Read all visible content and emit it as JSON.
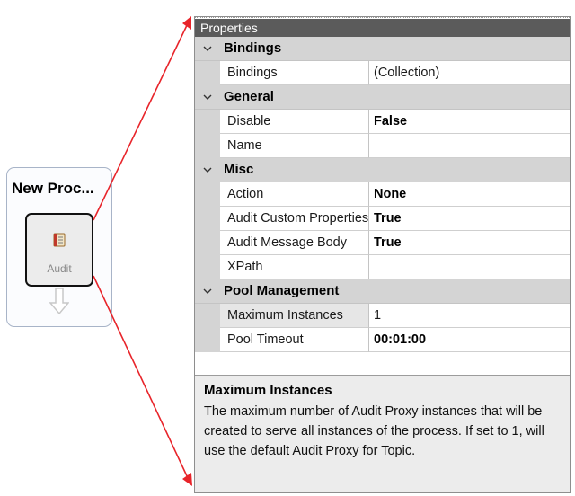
{
  "node": {
    "title": "New Proc...",
    "shape_label": "Audit",
    "shape_icon": "audit-book-icon"
  },
  "panel": {
    "title": "Properties",
    "categories": [
      {
        "label": "Bindings",
        "rows": [
          {
            "name": "Bindings",
            "value": "(Collection)",
            "bold": false
          }
        ]
      },
      {
        "label": "General",
        "rows": [
          {
            "name": "Disable",
            "value": "False",
            "bold": true
          },
          {
            "name": "Name",
            "value": "",
            "bold": false
          }
        ]
      },
      {
        "label": "Misc",
        "rows": [
          {
            "name": "Action",
            "value": "None",
            "bold": true
          },
          {
            "name": "Audit Custom Properties",
            "value": "True",
            "bold": true
          },
          {
            "name": "Audit Message Body",
            "value": "True",
            "bold": true
          },
          {
            "name": "XPath",
            "value": "",
            "bold": false
          }
        ]
      },
      {
        "label": "Pool Management",
        "rows": [
          {
            "name": "Maximum Instances",
            "value": "1",
            "bold": false
          },
          {
            "name": "Pool Timeout",
            "value": "00:01:00",
            "bold": true
          }
        ]
      }
    ],
    "description": {
      "title": "Maximum Instances",
      "text": "The maximum number of Audit Proxy instances that will be created to serve all instances of the process. If set to 1, will use the default Audit Proxy for Topic."
    }
  },
  "colors": {
    "titlebar": "#5b5b5b",
    "category_band": "#d4d4d4",
    "callout_arrow": "#e8242a",
    "description_bg": "#ececec"
  }
}
